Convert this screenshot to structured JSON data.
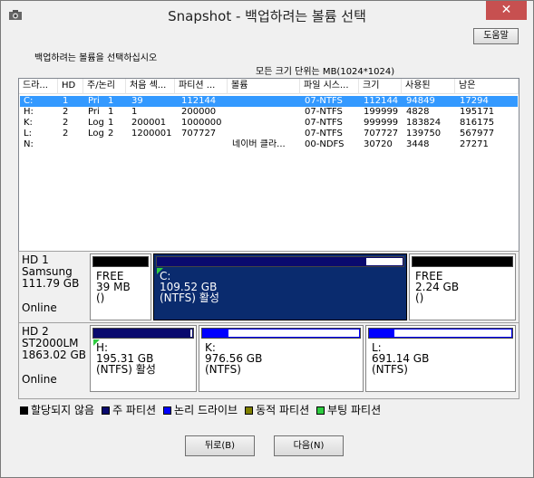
{
  "window": {
    "title": "Snapshot - 백업하려는 볼륨 선택",
    "close_glyph": "✕"
  },
  "header": {
    "help_label": "도움말",
    "instruction": "백업하려는 볼륨을 선택하십시오",
    "size_note": "모든 크기 단위는 MB(1024*1024)"
  },
  "list": {
    "columns": [
      "드라...",
      "HD",
      "주/논리",
      "처음 섹...",
      "파티션 ...",
      "볼륨",
      "파일 시스...",
      "크기",
      "사용된",
      "남은"
    ],
    "rows": [
      {
        "drive": "C:",
        "hd": "1",
        "type": "Pri",
        "num": "1",
        "start": "39",
        "part": "112144",
        "vol": "",
        "fs": "07-NTFS",
        "size": "112144",
        "used": "94849",
        "free": "17294",
        "selected": true
      },
      {
        "drive": "H:",
        "hd": "2",
        "type": "Pri",
        "num": "1",
        "start": "1",
        "part": "200000",
        "vol": "",
        "fs": "07-NTFS",
        "size": "199999",
        "used": "4828",
        "free": "195171",
        "selected": false
      },
      {
        "drive": "K:",
        "hd": "2",
        "type": "Log",
        "num": "1",
        "start": "200001",
        "part": "1000000",
        "vol": "",
        "fs": "07-NTFS",
        "size": "999999",
        "used": "183824",
        "free": "816175",
        "selected": false
      },
      {
        "drive": "L:",
        "hd": "2",
        "type": "Log",
        "num": "2",
        "start": "1200001",
        "part": "707727",
        "vol": "",
        "fs": "07-NTFS",
        "size": "707727",
        "used": "139750",
        "free": "567977",
        "selected": false
      },
      {
        "drive": "N:",
        "hd": "",
        "type": "",
        "num": "",
        "start": "",
        "part": "",
        "vol": "네이버 클라...",
        "fs": "00-NDFS",
        "size": "30720",
        "used": "3448",
        "free": "27271",
        "selected": false
      }
    ]
  },
  "disks": [
    {
      "label": "HD 1\nSamsung\n111.79 GB",
      "status": "Online",
      "partitions": [
        {
          "text": "FREE\n39 MB\n()",
          "kind": "free",
          "used_fraction": 1.0,
          "selected": false,
          "boot": false
        },
        {
          "text": "C:\n109.52 GB\n(NTFS) 활성",
          "kind": "primary",
          "used_fraction": 0.85,
          "selected": true,
          "boot": true
        },
        {
          "text": "FREE\n2.24 GB\n()",
          "kind": "free",
          "used_fraction": 1.0,
          "selected": false,
          "boot": false
        }
      ]
    },
    {
      "label": "HD 2\nST2000LM\n1863.02 GB",
      "status": "Online",
      "partitions": [
        {
          "text": "H:\n195.31 GB\n(NTFS) 활성",
          "kind": "primary",
          "used_fraction": 0.98,
          "selected": false,
          "boot": true
        },
        {
          "text": "K:\n976.56 GB\n(NTFS)",
          "kind": "logical",
          "used_fraction": 0.16,
          "selected": false,
          "boot": false
        },
        {
          "text": "L:\n691.14 GB\n(NTFS)",
          "kind": "logical",
          "used_fraction": 0.17,
          "selected": false,
          "boot": false
        }
      ]
    }
  ],
  "legend": [
    {
      "label": "할당되지 않음",
      "color": "#000000"
    },
    {
      "label": "주 파티션",
      "color": "#0a0a6e"
    },
    {
      "label": "논리 드라이브",
      "color": "#0000ff"
    },
    {
      "label": "동적 파티션",
      "color": "#808000"
    },
    {
      "label": "부팅 파티션",
      "color": "#2ecc40"
    }
  ],
  "buttons": {
    "back": "뒤로(B)",
    "next": "다음(N)"
  }
}
